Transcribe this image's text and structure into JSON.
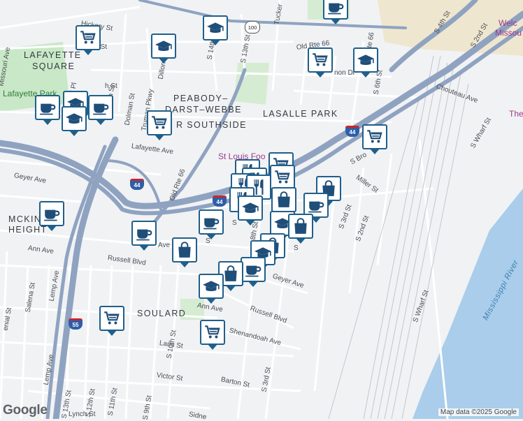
{
  "attribution": {
    "logo": "Google",
    "map_data": "Map data ©2025 Google"
  },
  "areas": {
    "lafayette_square_1": "LAFAYETTE",
    "lafayette_square_2": "SQUARE",
    "peabody_1": "PEABODY–",
    "peabody_2": "DARST–WEBBE",
    "near_southside": "R SOUTHSIDE",
    "lasalle_park": "LASALLE PARK",
    "mckinley_heights_1": "MCKIN",
    "mckinley_heights_2": "HEIGHT",
    "soulard": "SOULARD"
  },
  "places": {
    "lafayette_park": "Lafayette Park",
    "st_louis_food": "St Louis Foo",
    "welcome_1": "Welc",
    "welcome_2": "Missou",
    "the": "The",
    "mississippi_river": "Mississippi River"
  },
  "streets": {
    "hickory": "Hickory St",
    "park": "er St",
    "s_14th": "S 14th St",
    "s_13th": "S 13th St",
    "tucker": "Tucker",
    "old_rte_66_a": "Old Rte 66",
    "old_rte_66_b": "Old Rte 66",
    "old_rte_66_c": "Old Rte 66",
    "cannon": "non Dr",
    "s_6th": "S 6th St",
    "s_4th": "S 4th St",
    "s_2nd_top": "S 2nd St",
    "chouteau": "Chouteau Ave",
    "missouri": "Missouri Ave",
    "vail": "Vail Pl",
    "th_st": "h St",
    "dillon": "Dillon Dr",
    "truman": "Truman Pkwy",
    "dolman": "Dolman St",
    "lafayette_ave": "Lafayette Ave",
    "geyer_west": "Geyer Ave",
    "geyer_east": "Geyer Ave",
    "s_broadway": "S Bro",
    "miller": "Miller St",
    "s_3rd_a": "S 3rd St",
    "s_2nd_b": "S 2nd St",
    "s_wharf_a": "S Wharf St",
    "s_wharf_b": "S Wharf St",
    "ann_west": "Ann Ave",
    "ann_east": "Ann Ave",
    "russell_west": "Russell Blvd",
    "russell_east": "Russell Blvd",
    "ave_short": "Ave",
    "salena": "Salena St",
    "lemp_a": "Lemp Ave",
    "lemp_b": "Lemp Ave",
    "ernst": "enial St",
    "s_10th": "S 10th St",
    "s_11th": "S 11th St",
    "s_12th": "S 12th St",
    "s_13th_b": "S 13th St",
    "lami": "Lami St",
    "shenandoah": "Shenandoah Ave",
    "victor": "Victor St",
    "barton": "Barton St",
    "s_3rd_b": "S 3rd St",
    "s_9th": "S 9th St",
    "s_8th": "8th St",
    "lynch": "Lynch St",
    "sidney": "Sidne",
    "s_a": "S",
    "s_b": "S",
    "s_c": "S",
    "h_st": "h St"
  },
  "shields": {
    "i44_a": "44",
    "i44_b": "44",
    "i44_c": "44",
    "i55": "55",
    "us100": "100"
  },
  "icons": {
    "grocery": "shopping-cart-icon",
    "coffee": "coffee-cup-icon",
    "school": "graduation-cap-icon",
    "restaurant": "fork-knife-icon",
    "shopping": "shopping-bag-icon"
  },
  "colors": {
    "marker_border": "#1f5f8b",
    "icon": "#1f4e79",
    "highway": "#8fa3c1",
    "river": "#a9cdea",
    "park": "#c9e8c7",
    "poi": "#9b3a8a"
  }
}
